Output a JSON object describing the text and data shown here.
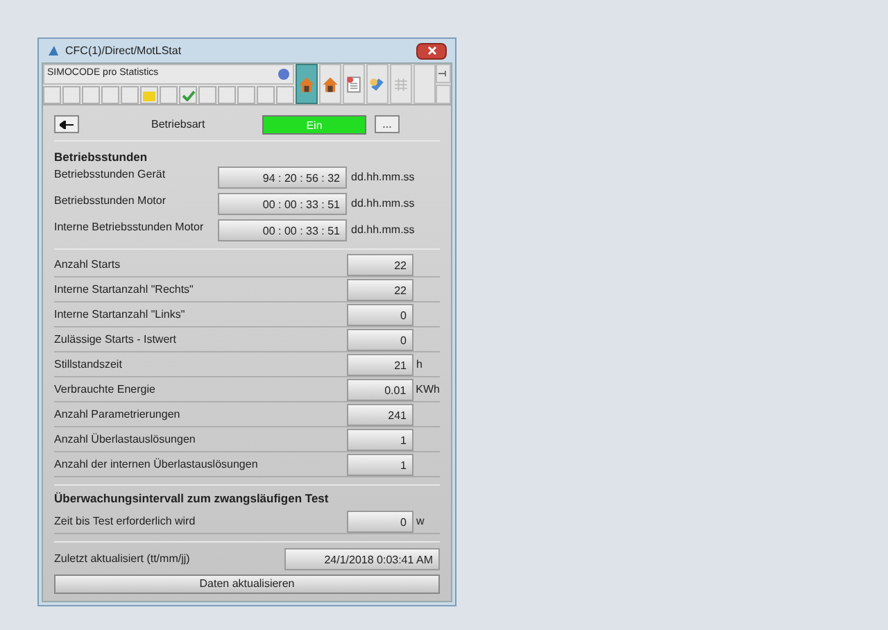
{
  "window": {
    "title": "CFC(1)/Direct/MotLStat"
  },
  "toolbar": {
    "label": "SIMOCODE pro Statistics",
    "buttons": [
      {
        "kind": "house",
        "selected": true
      },
      {
        "kind": "house",
        "selected": false
      },
      {
        "kind": "document",
        "selected": false
      },
      {
        "kind": "tool",
        "selected": false
      },
      {
        "kind": "grid",
        "selected": false
      },
      {
        "kind": "blank",
        "selected": false
      }
    ],
    "slots": [
      {
        "kind": "empty"
      },
      {
        "kind": "empty"
      },
      {
        "kind": "empty"
      },
      {
        "kind": "empty"
      },
      {
        "kind": "empty"
      },
      {
        "kind": "folder"
      },
      {
        "kind": "empty"
      },
      {
        "kind": "check"
      },
      {
        "kind": "empty"
      },
      {
        "kind": "empty"
      },
      {
        "kind": "empty"
      },
      {
        "kind": "empty"
      },
      {
        "kind": "empty"
      }
    ]
  },
  "mode": {
    "label": "Betriebsart",
    "value": "Ein",
    "on": true,
    "more": "..."
  },
  "hours": {
    "heading": "Betriebsstunden",
    "rows": [
      {
        "label": "Betriebsstunden Gerät",
        "value": "94 : 20 : 56 : 32",
        "unit": "dd.hh.mm.ss"
      },
      {
        "label": "Betriebsstunden Motor",
        "value": "00 : 00 : 33 : 51",
        "unit": "dd.hh.mm.ss"
      },
      {
        "label": "Interne Betriebsstunden Motor",
        "value": "00 : 00 : 33 : 51",
        "unit": "dd.hh.mm.ss"
      }
    ]
  },
  "counters": [
    {
      "label": "Anzahl Starts",
      "value": "22"
    },
    {
      "label": "Interne Startanzahl \"Rechts\"",
      "value": "22"
    },
    {
      "label": "Interne Startanzahl \"Links\"",
      "value": "0"
    },
    {
      "label": "Zulässige Starts - Istwert",
      "value": "0"
    },
    {
      "label": "Stillstandszeit",
      "value": "21",
      "unit": "h"
    },
    {
      "label": "Verbrauchte Energie",
      "value": "0.01",
      "unit": "KWh"
    },
    {
      "label": "Anzahl Parametrierungen",
      "value": "241"
    },
    {
      "label": "Anzahl Überlastauslösungen",
      "value": "1"
    },
    {
      "label": "Anzahl der internen Überlastauslösungen",
      "value": "1"
    }
  ],
  "test": {
    "heading": "Überwachungsintervall zum zwangsläufigen Test",
    "label": "Zeit bis Test erforderlich wird",
    "value": "0",
    "unit": "w"
  },
  "updated": {
    "label": "Zuletzt aktualisiert (tt/mm/jj)",
    "value": "24/1/2018  0:03:41 AM"
  },
  "refresh_button": "Daten aktualisieren"
}
